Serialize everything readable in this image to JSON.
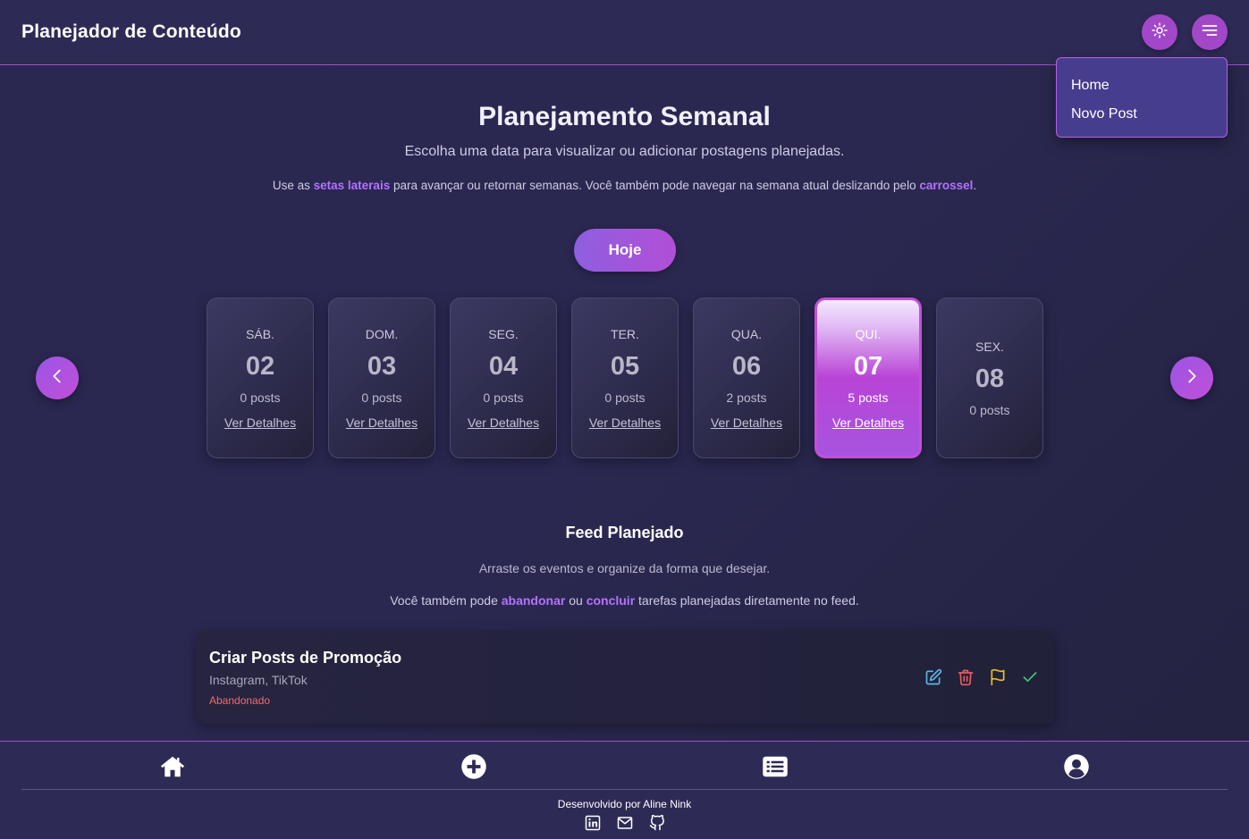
{
  "header": {
    "title": "Planejador de Conteúdo",
    "theme_icon": "sun-icon",
    "menu_icon": "menu-icon"
  },
  "dropdown": {
    "items": [
      "Home",
      "Novo Post"
    ]
  },
  "hero": {
    "title": "Planejamento Semanal",
    "subtitle": "Escolha uma data para visualizar ou adicionar postagens planejadas.",
    "hint_prefix": "Use as ",
    "hint_accent1": "setas laterais",
    "hint_middle": " para avançar ou retornar semanas. Você também pode navegar na semana atual deslizando pelo ",
    "hint_accent2": "carrossel",
    "hint_suffix": ".",
    "today_label": "Hoje"
  },
  "carousel": {
    "prev_icon": "chevron-left-icon",
    "next_icon": "chevron-right-icon",
    "days": [
      {
        "name": "SÁB.",
        "num": "02",
        "posts": "0 posts",
        "link": "Ver Detalhes"
      },
      {
        "name": "DOM.",
        "num": "03",
        "posts": "0 posts",
        "link": "Ver Detalhes"
      },
      {
        "name": "SEG.",
        "num": "04",
        "posts": "0 posts",
        "link": "Ver Detalhes"
      },
      {
        "name": "TER.",
        "num": "05",
        "posts": "0 posts",
        "link": "Ver Detalhes"
      },
      {
        "name": "QUA.",
        "num": "06",
        "posts": "2 posts",
        "link": "Ver Detalhes"
      },
      {
        "name": "QUI.",
        "num": "07",
        "posts": "5 posts",
        "link": "Ver Detalhes"
      },
      {
        "name": "SEX.",
        "num": "08",
        "posts": "0 posts"
      }
    ]
  },
  "feed": {
    "title": "Feed Planejado",
    "subtitle": "Arraste os eventos e organize da forma que desejar.",
    "hint_prefix": "Você também pode ",
    "hint_accent1": "abandonar",
    "hint_middle": " ou ",
    "hint_accent2": "concluir",
    "hint_suffix": " tarefas planejadas diretamente no feed.",
    "post": {
      "title": "Criar Posts de Promoção",
      "platforms": "Instagram, TikTok",
      "status": "Abandonado"
    }
  },
  "colors": {
    "accent": "#b472ff",
    "edit": "#5fb6e0",
    "delete": "#e85c5c",
    "abandon": "#e8c227",
    "complete": "#3cc77a"
  },
  "bottom_nav": {
    "icons": [
      "home-icon",
      "plus-circle-icon",
      "list-icon",
      "user-icon"
    ]
  },
  "footer": {
    "credit": "Desenvolvido por Aline Nink",
    "social_icons": [
      "linkedin-icon",
      "mail-icon",
      "github-icon"
    ]
  }
}
